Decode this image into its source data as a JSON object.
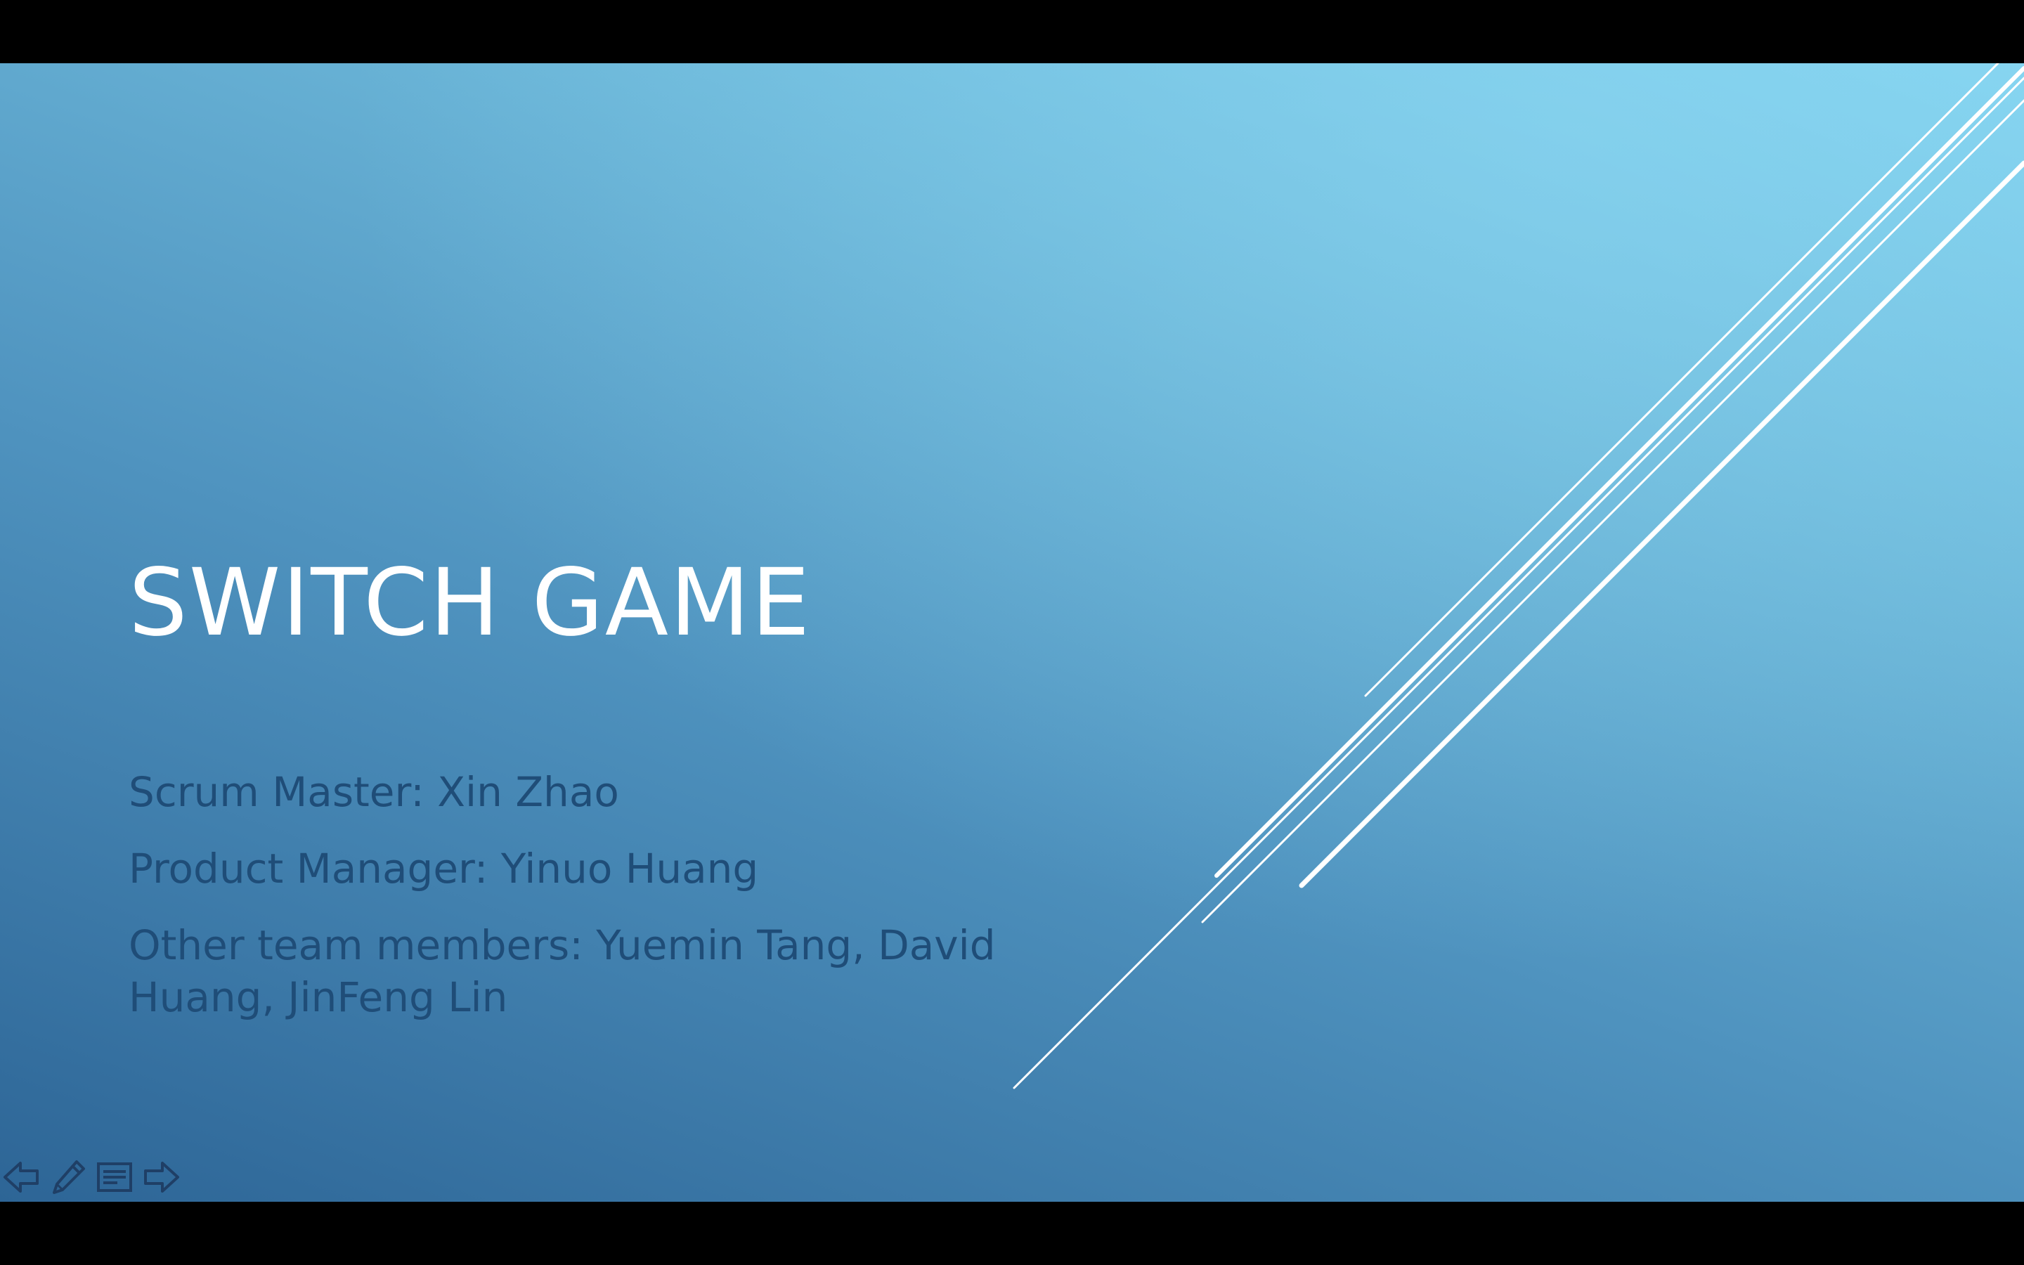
{
  "slide": {
    "title": "SWITCH GAME",
    "subtitle_lines": [
      "Scrum Master: Xin Zhao",
      "Product Manager: Yinuo Huang",
      "Other team members: Yuemin Tang, David Huang, JinFeng Lin"
    ]
  },
  "controls": [
    {
      "icon": "arrow-left-icon",
      "action": "previous-slide"
    },
    {
      "icon": "pen-icon",
      "action": "pen-tool"
    },
    {
      "icon": "notes-icon",
      "action": "slide-menu"
    },
    {
      "icon": "arrow-right-icon",
      "action": "next-slide"
    }
  ],
  "colors": {
    "letterbox": "#000000",
    "gradient_top": "#83d4f0",
    "gradient_bottom": "#2d6596",
    "title": "#ffffff",
    "subtitle": "#1f4d78",
    "control_icon": "#1f3f66"
  }
}
